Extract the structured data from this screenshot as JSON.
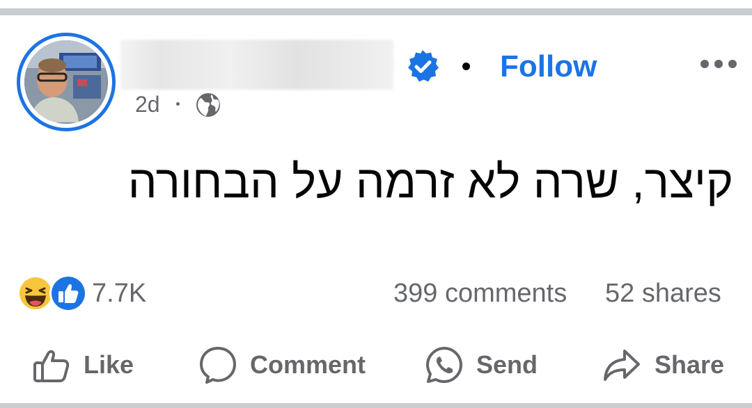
{
  "post": {
    "author": {
      "name": "",
      "verified": true,
      "avatar_icon": "avatar-photo"
    },
    "follow_label": "Follow",
    "time_ago": "2d",
    "audience_icon": "globe-icon",
    "text": "קיצר, שרה לא זרמה על הבחורה"
  },
  "stats": {
    "reactions": [
      "haha-icon",
      "like-icon"
    ],
    "reaction_count": "7.7K",
    "comments": "399 comments",
    "shares": "52 shares"
  },
  "actions": {
    "like": "Like",
    "comment": "Comment",
    "send": "Send",
    "share": "Share"
  },
  "colors": {
    "accent": "#1b74e4",
    "secondary_text": "#65676b",
    "primary_text": "#050505",
    "divider": "#c9ccd1"
  }
}
